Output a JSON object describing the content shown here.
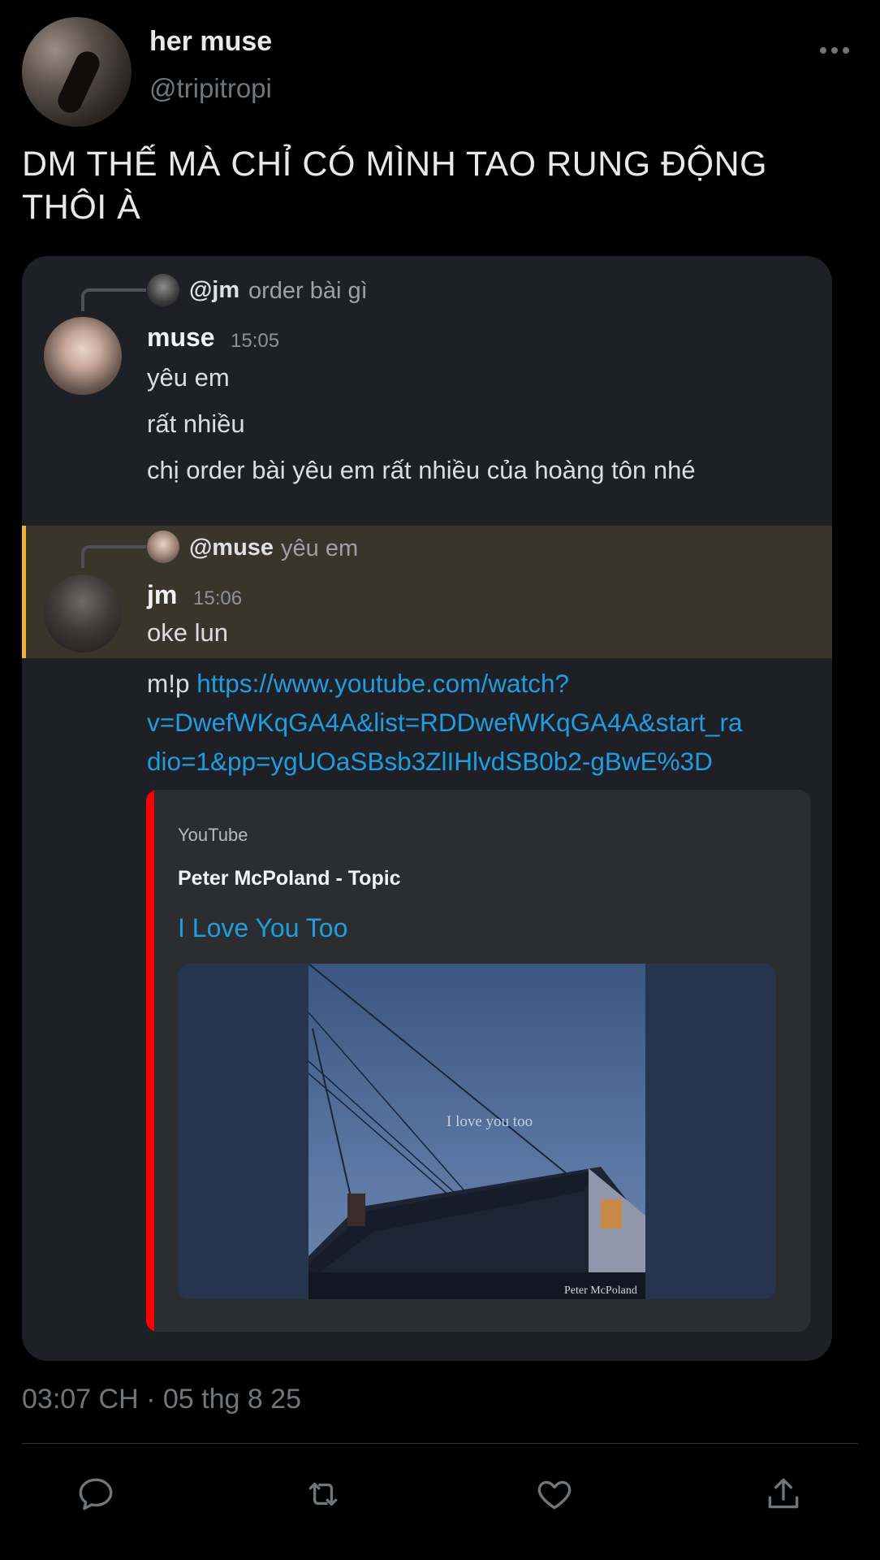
{
  "author": {
    "display_name": "her muse",
    "handle": "@tripitropi"
  },
  "tweet": {
    "text_line1": "DM THẾ MÀ CHỈ CÓ MÌNH TAO RUNG ĐỘNG",
    "text_line2": "THÔI À",
    "timestamp": "03:07 CH · 05 thg 8 25"
  },
  "discord": {
    "message1": {
      "reply_user": "@jm",
      "reply_text": "order bài gì",
      "author": "muse",
      "time": "15:05",
      "lines": [
        "yêu em",
        "rất nhiều",
        "chị order bài yêu em rất nhiều của hoàng tôn nhé"
      ]
    },
    "message2": {
      "reply_user": "@muse",
      "reply_text": "yêu em",
      "author": "jm",
      "time": "15:06",
      "line1": "oke lun",
      "link_prefix": "m!p",
      "link_lines": [
        "https://www.youtube.com/watch?",
        "v=DwefWKqGA4A&list=RDDwefWKqGA4A&start_ra",
        "dio=1&pp=ygUOaSBsb3ZlIHlvdSB0b2-gBwE%3D"
      ],
      "highlight_color": "#f0b232"
    },
    "embed": {
      "provider": "YouTube",
      "author": "Peter McPoland - Topic",
      "title": "I Love You Too",
      "accent_color": "#ff0000",
      "cover_text": "I love you too",
      "cover_artist": "Peter McPoland"
    }
  },
  "actions": [
    {
      "icon": "reply-icon"
    },
    {
      "icon": "retweet-icon"
    },
    {
      "icon": "like-icon"
    },
    {
      "icon": "share-icon"
    }
  ],
  "colors": {
    "background": "#000000",
    "discord_bg": "#1f2025",
    "link": "#1e9ee0",
    "secondary_text": "#71767b"
  }
}
